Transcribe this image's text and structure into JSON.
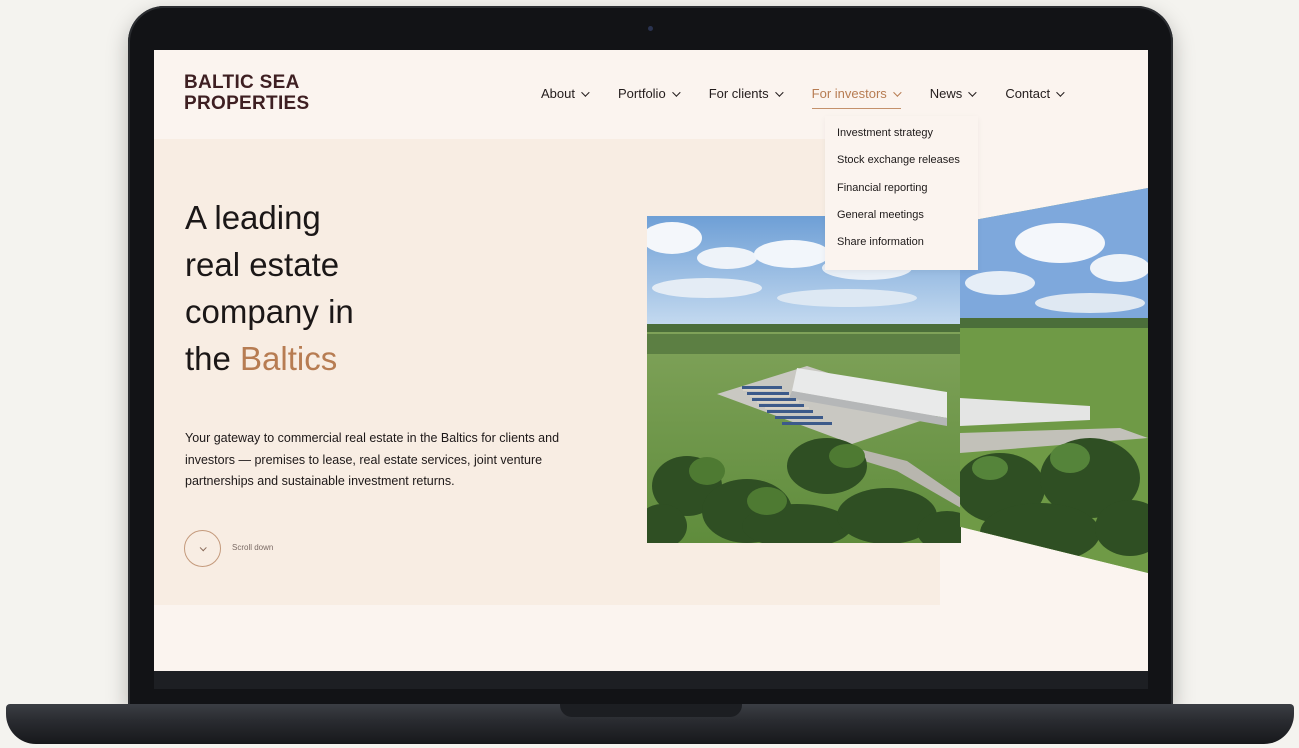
{
  "site": {
    "logo_line1": "BALTIC SEA",
    "logo_line2": "PROPERTIES"
  },
  "nav": {
    "items": [
      {
        "label": "About"
      },
      {
        "label": "Portfolio"
      },
      {
        "label": "For clients"
      },
      {
        "label": "For investors"
      },
      {
        "label": "News"
      },
      {
        "label": "Contact"
      }
    ],
    "active_index": 3
  },
  "dropdown": {
    "items": [
      {
        "label": "Investment strategy"
      },
      {
        "label": "Stock exchange releases"
      },
      {
        "label": "Financial reporting"
      },
      {
        "label": "General meetings"
      },
      {
        "label": "Share information"
      }
    ]
  },
  "hero": {
    "headline_line1": "A leading",
    "headline_line2": "real estate",
    "headline_line3": "company in",
    "headline_line4_prefix": "the ",
    "headline_line4_accent": "Baltics",
    "tagline": "Your gateway to commercial real estate in the Baltics for clients and investors — premises to lease, real estate services, joint venture partnerships and sustainable investment returns.",
    "scroll_label": "Scroll down"
  },
  "colors": {
    "accent": "#b77c52",
    "logo": "#3e1f22",
    "screen_bg": "#fbf4ef",
    "hero_band": "#f8ede3"
  },
  "icons": {
    "nav_chevron": "chevron-down-icon",
    "scroll_chevron": "chevron-down-icon"
  }
}
